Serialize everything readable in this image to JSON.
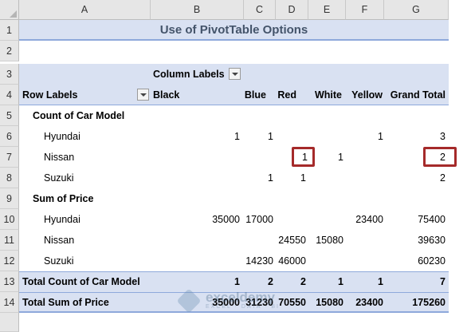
{
  "columns": [
    "A",
    "B",
    "C",
    "D",
    "E",
    "F",
    "G"
  ],
  "rows": [
    "1",
    "2",
    "3",
    "4",
    "5",
    "6",
    "7",
    "8",
    "9",
    "10",
    "11",
    "12",
    "13",
    "14"
  ],
  "title": "Use of PivotTable Options",
  "pivot": {
    "column_labels": "Column Labels",
    "row_labels": "Row Labels",
    "headers": [
      "Black",
      "Blue",
      "Red",
      "White",
      "Yellow",
      "Grand Total"
    ],
    "count_section": "Count of Car Model",
    "price_section": "Sum of Price",
    "count_rows": [
      {
        "label": "Hyundai",
        "values": [
          "1",
          "1",
          "",
          "",
          "1",
          "3"
        ]
      },
      {
        "label": "Nissan",
        "values": [
          "",
          "",
          "1",
          "1",
          "",
          "2"
        ]
      },
      {
        "label": "Suzuki",
        "values": [
          "",
          "1",
          "1",
          "",
          "",
          "2"
        ]
      }
    ],
    "price_rows": [
      {
        "label": "Hyundai",
        "values": [
          "35000",
          "17000",
          "",
          "",
          "23400",
          "75400"
        ]
      },
      {
        "label": "Nissan",
        "values": [
          "",
          "",
          "24550",
          "15080",
          "",
          "39630"
        ]
      },
      {
        "label": "Suzuki",
        "values": [
          "",
          "14230",
          "46000",
          "",
          "",
          "60230"
        ]
      }
    ],
    "total_count": {
      "label": "Total Count of Car Model",
      "values": [
        "1",
        "2",
        "2",
        "1",
        "1",
        "7"
      ]
    },
    "total_price": {
      "label": "Total Sum of Price",
      "values": [
        "35000",
        "31230",
        "70550",
        "15080",
        "23400",
        "175260"
      ]
    }
  },
  "watermark": {
    "name": "exceldemy",
    "tagline": "EXCEL · DATA · BI"
  },
  "colors": {
    "header_fill": "#d9e1f2",
    "header_border": "#8ea9db",
    "title_text": "#44546a",
    "highlight": "#a52a2a"
  }
}
